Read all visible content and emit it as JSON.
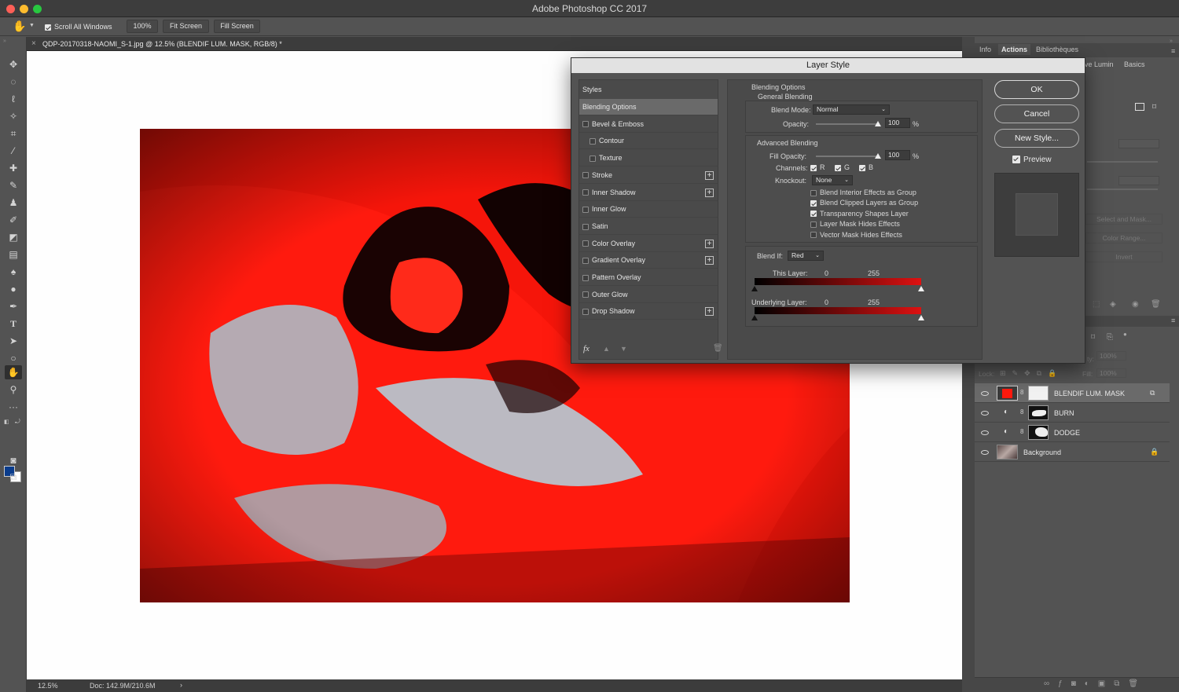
{
  "app": {
    "title": "Adobe Photoshop CC 2017"
  },
  "options_bar": {
    "scroll_all_windows_label": "Scroll All Windows",
    "scroll_all_windows_checked": true,
    "zoom_button": "100%",
    "fit_screen_button": "Fit Screen",
    "fill_screen_button": "Fill Screen"
  },
  "document": {
    "tab_title": "QDP-20170318-NAOMI_S-1.jpg @ 12.5% (BLENDIF LUM. MASK, RGB/8) *",
    "close_glyph": "×"
  },
  "status_bar": {
    "zoom": "12.5%",
    "doc_size": "Doc: 142.9M/210.6M",
    "arrow": "›"
  },
  "panels": {
    "tabs": [
      "Info",
      "Actions",
      "Bibliothèques"
    ],
    "active_tab": "Actions",
    "sub_tabs": [
      "ive Lumin",
      "Basics"
    ],
    "properties_buttons": [
      "Select and Mask...",
      "Color Range...",
      "Invert"
    ],
    "lock_label": "Lock:",
    "fill_label": "Fill:",
    "fill_value": "100%",
    "opacity_fragment": "ty:",
    "opacity_value": "100%"
  },
  "layers": [
    {
      "name": "BLENDIF LUM. MASK",
      "thumb": "red",
      "mask": "white",
      "selected": true
    },
    {
      "name": "BURN",
      "thumb": "adjust",
      "mask": "burn",
      "selected": false
    },
    {
      "name": "DODGE",
      "thumb": "adjust",
      "mask": "dodge",
      "selected": false
    },
    {
      "name": "Background",
      "thumb": "photo",
      "mask": "",
      "selected": false
    }
  ],
  "dialog": {
    "title": "Layer Style",
    "styles_header": "Styles",
    "style_items": [
      {
        "label": "Blending Options",
        "checkbox": false,
        "checked": false,
        "plus": false,
        "active": true,
        "indent": false
      },
      {
        "label": "Bevel & Emboss",
        "checkbox": true,
        "checked": false,
        "plus": false,
        "active": false,
        "indent": false
      },
      {
        "label": "Contour",
        "checkbox": true,
        "checked": false,
        "plus": false,
        "active": false,
        "indent": true
      },
      {
        "label": "Texture",
        "checkbox": true,
        "checked": false,
        "plus": false,
        "active": false,
        "indent": true
      },
      {
        "label": "Stroke",
        "checkbox": true,
        "checked": false,
        "plus": true,
        "active": false,
        "indent": false
      },
      {
        "label": "Inner Shadow",
        "checkbox": true,
        "checked": false,
        "plus": true,
        "active": false,
        "indent": false
      },
      {
        "label": "Inner Glow",
        "checkbox": true,
        "checked": false,
        "plus": false,
        "active": false,
        "indent": false
      },
      {
        "label": "Satin",
        "checkbox": true,
        "checked": false,
        "plus": false,
        "active": false,
        "indent": false
      },
      {
        "label": "Color Overlay",
        "checkbox": true,
        "checked": false,
        "plus": true,
        "active": false,
        "indent": false
      },
      {
        "label": "Gradient Overlay",
        "checkbox": true,
        "checked": false,
        "plus": true,
        "active": false,
        "indent": false
      },
      {
        "label": "Pattern Overlay",
        "checkbox": true,
        "checked": false,
        "plus": false,
        "active": false,
        "indent": false
      },
      {
        "label": "Outer Glow",
        "checkbox": true,
        "checked": false,
        "plus": false,
        "active": false,
        "indent": false
      },
      {
        "label": "Drop Shadow",
        "checkbox": true,
        "checked": false,
        "plus": true,
        "active": false,
        "indent": false
      }
    ],
    "fx_label": "fx",
    "blending_options_header": "Blending Options",
    "general_blending_header": "General Blending",
    "blend_mode_label": "Blend Mode:",
    "blend_mode_value": "Normal",
    "opacity_label": "Opacity:",
    "opacity_value": "100",
    "percent": "%",
    "advanced_blending_header": "Advanced Blending",
    "fill_opacity_label": "Fill Opacity:",
    "fill_opacity_value": "100",
    "channels_label": "Channels:",
    "channels": [
      {
        "label": "R",
        "checked": true
      },
      {
        "label": "G",
        "checked": true
      },
      {
        "label": "B",
        "checked": true
      }
    ],
    "knockout_label": "Knockout:",
    "knockout_value": "None",
    "advanced_options": [
      {
        "label": "Blend Interior Effects as Group",
        "checked": false
      },
      {
        "label": "Blend Clipped Layers as Group",
        "checked": true
      },
      {
        "label": "Transparency Shapes Layer",
        "checked": true
      },
      {
        "label": "Layer Mask Hides Effects",
        "checked": false
      },
      {
        "label": "Vector Mask Hides Effects",
        "checked": false
      }
    ],
    "blend_if_label": "Blend If:",
    "blend_if_value": "Red",
    "this_layer_label": "This Layer:",
    "this_layer_min": "0",
    "this_layer_max": "255",
    "underlying_layer_label": "Underlying Layer:",
    "underlying_layer_min": "0",
    "underlying_layer_max": "255",
    "ok_button": "OK",
    "cancel_button": "Cancel",
    "new_style_button": "New Style...",
    "preview_label": "Preview",
    "preview_checked": true
  },
  "colors": {
    "accent_red": "#ff1a0e",
    "foreground_swatch": "#0a3c8c",
    "background_swatch": "#ffffff"
  }
}
